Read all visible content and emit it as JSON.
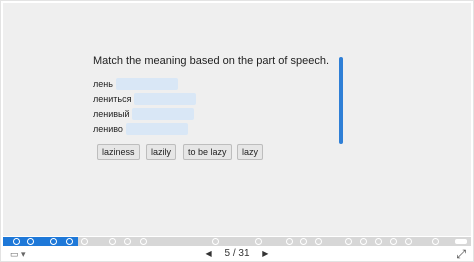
{
  "prompt": "Match the meaning based on the part of speech.",
  "words": [
    {
      "label": "лень"
    },
    {
      "label": "лениться"
    },
    {
      "label": "ленивый"
    },
    {
      "label": "лениво"
    }
  ],
  "options": [
    "laziness",
    "lazily",
    "to be lazy",
    "lazy"
  ],
  "pager": {
    "current": "5",
    "separator": "/",
    "total": "31",
    "prev_icon": "triangle-left",
    "next_icon": "triangle-right"
  },
  "progress": {
    "fraction": 0.16
  },
  "colors": {
    "accent": "#1e78d8",
    "drop_zone": "#d9e7f6",
    "slide_bg": "#efefef"
  },
  "icons": {
    "layout": "slides-icon",
    "expand": "expand-icon"
  }
}
